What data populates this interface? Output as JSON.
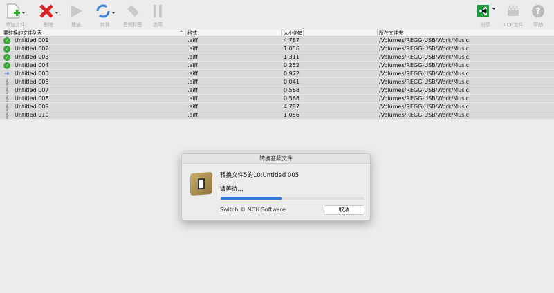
{
  "toolbar": {
    "add": "添加文件",
    "delete": "删除",
    "play": "播放",
    "convert": "转换",
    "tags": "音频标签",
    "options": "选项",
    "share": "分享",
    "nch": "NCH套件",
    "help": "帮助"
  },
  "table": {
    "headers": [
      "要转换的文件列表",
      "格式",
      "大小(MB)",
      "所在文件夹"
    ],
    "rows": [
      {
        "status": "done",
        "name": "Untitled 001",
        "format": ".aiff",
        "size": "4.787",
        "path": "/Volumes/REGG-USB/Work/Music"
      },
      {
        "status": "done",
        "name": "Untitled 002",
        "format": ".aiff",
        "size": "1.056",
        "path": "/Volumes/REGG-USB/Work/Music"
      },
      {
        "status": "done",
        "name": "Untitled 003",
        "format": ".aiff",
        "size": "1.311",
        "path": "/Volumes/REGG-USB/Work/Music"
      },
      {
        "status": "done",
        "name": "Untitled 004",
        "format": ".aiff",
        "size": "0.252",
        "path": "/Volumes/REGG-USB/Work/Music"
      },
      {
        "status": "converting",
        "name": "Untitled 005",
        "format": ".aiff",
        "size": "0.972",
        "path": "/Volumes/REGG-USB/Work/Music"
      },
      {
        "status": "pending",
        "name": "Untitled 006",
        "format": ".aiff",
        "size": "0.041",
        "path": "/Volumes/REGG-USB/Work/Music"
      },
      {
        "status": "pending",
        "name": "Untitled 007",
        "format": ".aiff",
        "size": "0.568",
        "path": "/Volumes/REGG-USB/Work/Music"
      },
      {
        "status": "pending",
        "name": "Untitled 008",
        "format": ".aiff",
        "size": "0.568",
        "path": "/Volumes/REGG-USB/Work/Music"
      },
      {
        "status": "pending",
        "name": "Untitled 009",
        "format": ".aiff",
        "size": "4.787",
        "path": "/Volumes/REGG-USB/Work/Music"
      },
      {
        "status": "pending",
        "name": "Untitled 010",
        "format": ".aiff",
        "size": "1.056",
        "path": "/Volumes/REGG-USB/Work/Music"
      }
    ]
  },
  "dialog": {
    "title": "转换音频文件",
    "message": "转换文件5的10:Untitled 005",
    "wait": "请等待...",
    "progress_percent": 43,
    "copyright": "Switch © NCH Software",
    "cancel": "取消"
  }
}
